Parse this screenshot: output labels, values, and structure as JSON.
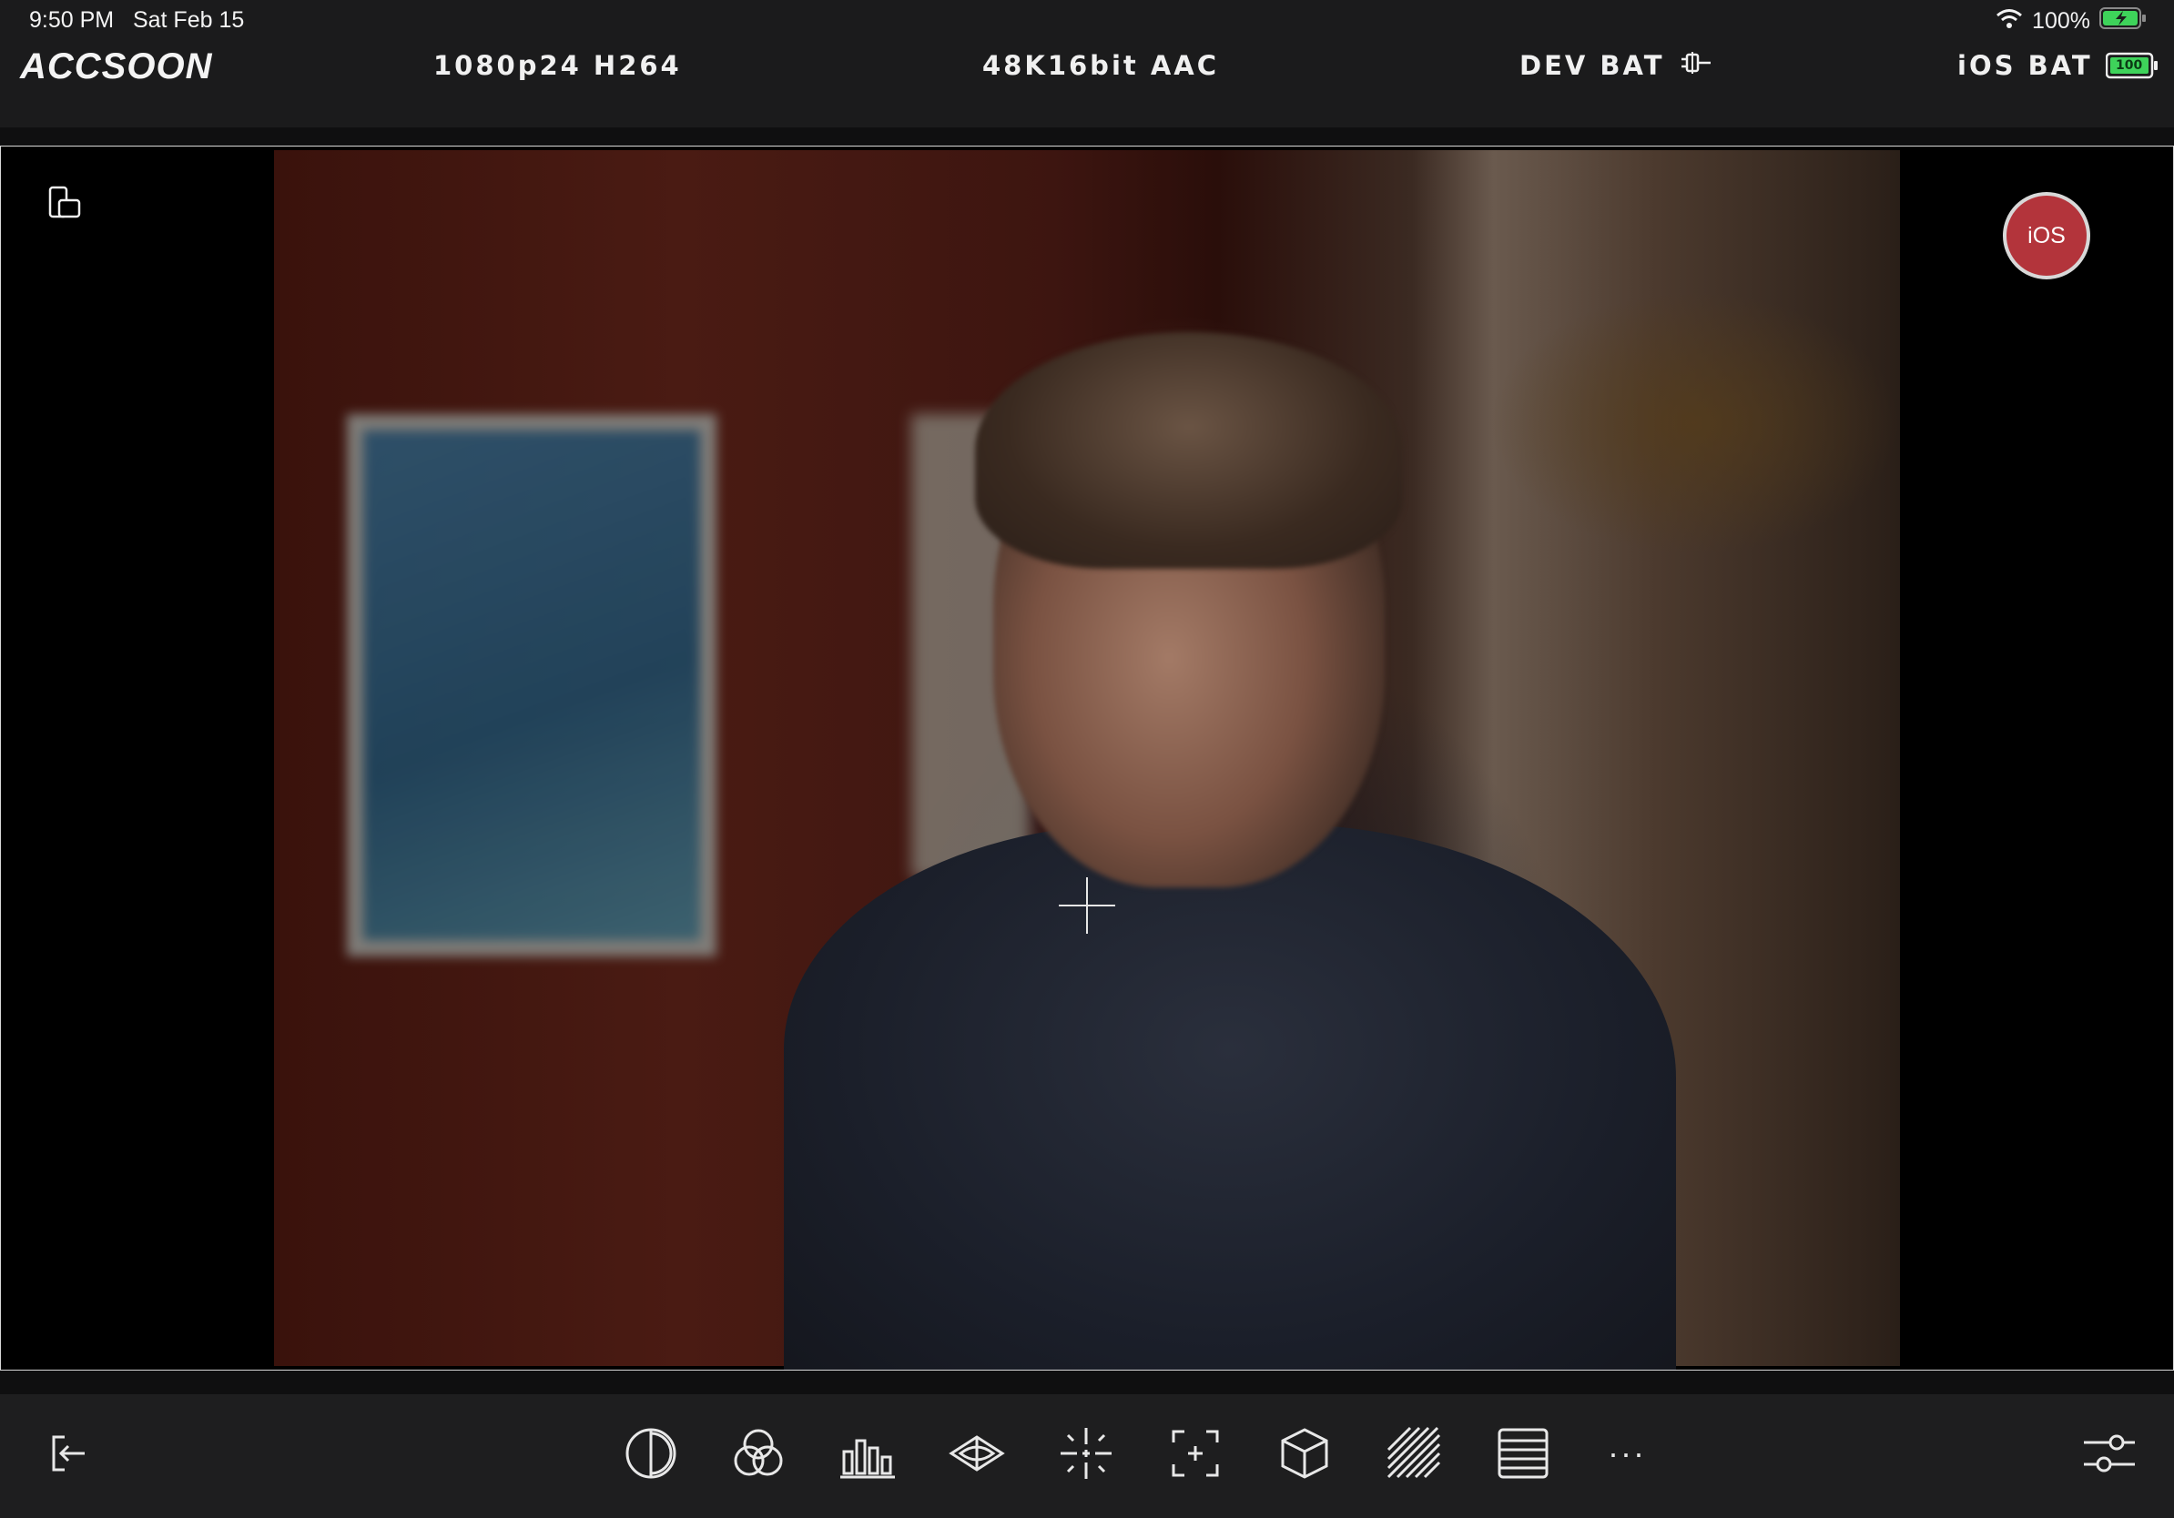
{
  "status_bar": {
    "time": "9:50 PM",
    "date": "Sat Feb 15",
    "battery_percent": "100%",
    "wifi_icon": "wifi-icon",
    "battery_icon": "battery-charging-icon"
  },
  "top_bar": {
    "brand": "ACCSOON",
    "video_format": "1080p24 H264",
    "audio_format": "48K16bit AAC",
    "device_battery_label": "DEV BAT",
    "ios_battery_label": "iOS BAT",
    "ios_battery_value": "100"
  },
  "viewport": {
    "ios_button_label": "iOS",
    "orientation_icon": "device-orientation-icon",
    "crosshair_icon": "center-crosshair-icon"
  },
  "toolbar": {
    "exit_icon": "exit-icon",
    "tools": [
      {
        "name": "false-color-icon"
      },
      {
        "name": "rgb-channels-icon"
      },
      {
        "name": "histogram-icon"
      },
      {
        "name": "focus-peaking-icon"
      },
      {
        "name": "zoom-crosshair-icon"
      },
      {
        "name": "center-marker-icon"
      },
      {
        "name": "lut-cube-icon"
      },
      {
        "name": "zebra-icon"
      },
      {
        "name": "frame-lines-icon"
      }
    ],
    "more_label": "···",
    "settings_icon": "settings-sliders-icon"
  },
  "colors": {
    "background": "#1e1e1f",
    "record_button": "#b3343b",
    "battery_green": "#3ed35a"
  }
}
